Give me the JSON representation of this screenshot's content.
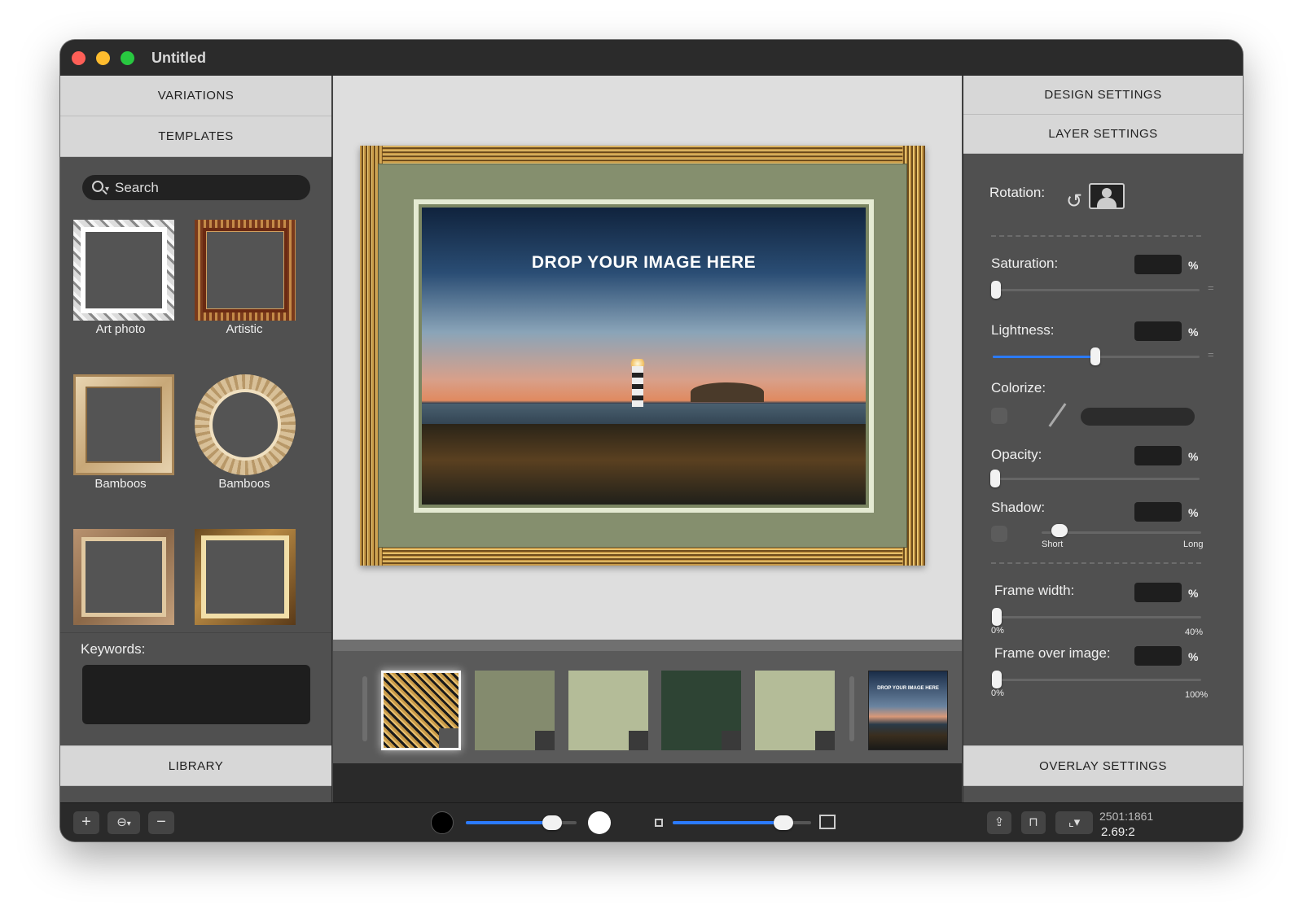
{
  "window": {
    "title": "Untitled"
  },
  "left_panel": {
    "variations_label": "VARIATIONS",
    "templates_label": "TEMPLATES",
    "search_placeholder": "Search",
    "templates": [
      {
        "label": "Art photo"
      },
      {
        "label": "Artistic"
      },
      {
        "label": "Bamboos"
      },
      {
        "label": "Bamboos"
      }
    ],
    "keywords_label": "Keywords:",
    "library_label": "LIBRARY"
  },
  "bottom_left": {
    "add": "+",
    "remove": "−"
  },
  "canvas": {
    "drop_text": "DROP YOUR IMAGE HERE"
  },
  "strip": {
    "swatch_colors": [
      "#848b6e",
      "#b4bc98",
      "#2e4434",
      "#b4bc98"
    ],
    "thumb_text": "DROP YOUR IMAGE HERE"
  },
  "right_panel": {
    "design_settings_label": "DESIGN SETTINGS",
    "layer_settings_label": "LAYER SETTINGS",
    "rotation_label": "Rotation:",
    "saturation_label": "Saturation:",
    "lightness_label": "Lightness:",
    "colorize_label": "Colorize:",
    "opacity_label": "Opacity:",
    "shadow_label": "Shadow:",
    "shadow_short": "Short",
    "shadow_long": "Long",
    "frame_width_label": "Frame width:",
    "frame_width_min": "0%",
    "frame_width_max": "40%",
    "frame_over_label": "Frame over image:",
    "frame_over_min": "0%",
    "frame_over_max": "100%",
    "pct": "%",
    "overlay_settings_label": "OVERLAY SETTINGS"
  },
  "status": {
    "size": "2501:1861",
    "ratio": "2.69:2"
  }
}
